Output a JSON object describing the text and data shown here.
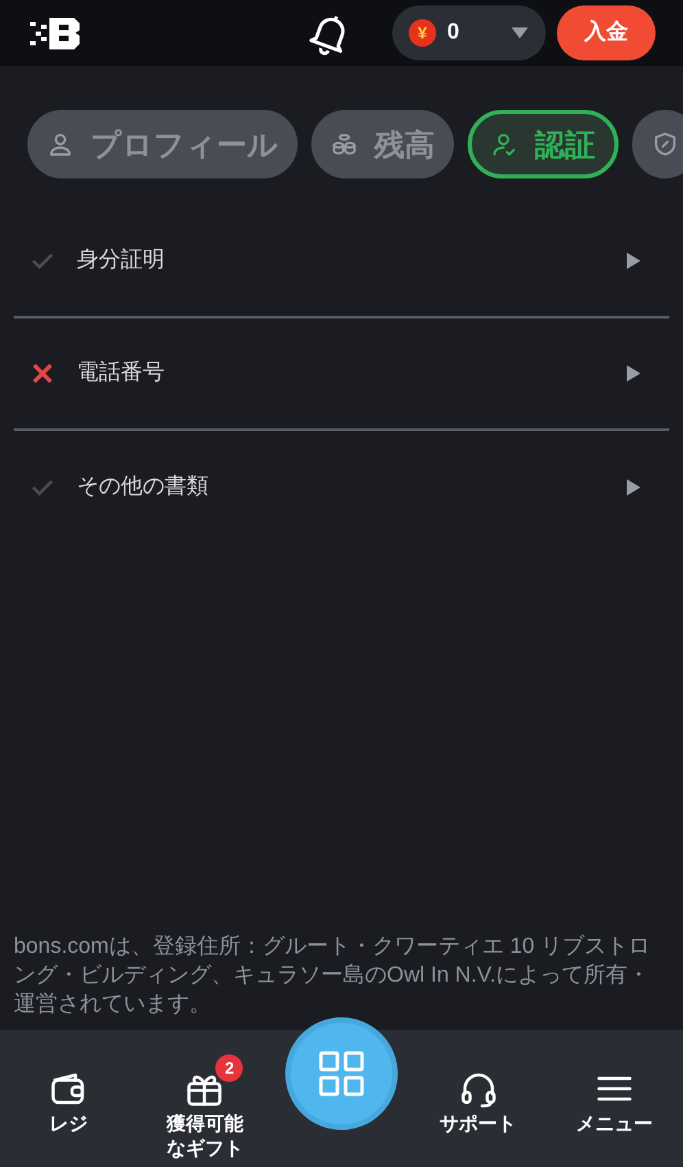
{
  "header": {
    "balance": "0",
    "currency_symbol": "¥",
    "deposit_button": "入金"
  },
  "tabs": [
    {
      "kind": "profile",
      "label": "プロフィール",
      "selected": false
    },
    {
      "kind": "balance",
      "label": "残高",
      "selected": false
    },
    {
      "kind": "verification",
      "label": "認証",
      "selected": true
    },
    {
      "kind": "security",
      "selected": false
    }
  ],
  "items": [
    {
      "kind": "check",
      "label": "身分証明"
    },
    {
      "kind": "cross",
      "label": "電話番号"
    },
    {
      "kind": "check",
      "label": "その他の書類"
    }
  ],
  "footer_text": "bons.comは、登録住所：グルート・クワーティエ 10 リブストロング・ビルディング、キュラソー島のOwl In N.V.によって所有・運営されています。",
  "nav": [
    {
      "kind": "wallet",
      "label": "レジ"
    },
    {
      "kind": "gift",
      "label": "獲得可能なギフト",
      "badge": "2"
    },
    {
      "kind": "center"
    },
    {
      "kind": "support",
      "label": "サポート"
    },
    {
      "kind": "menu",
      "label": "メニュー"
    }
  ]
}
